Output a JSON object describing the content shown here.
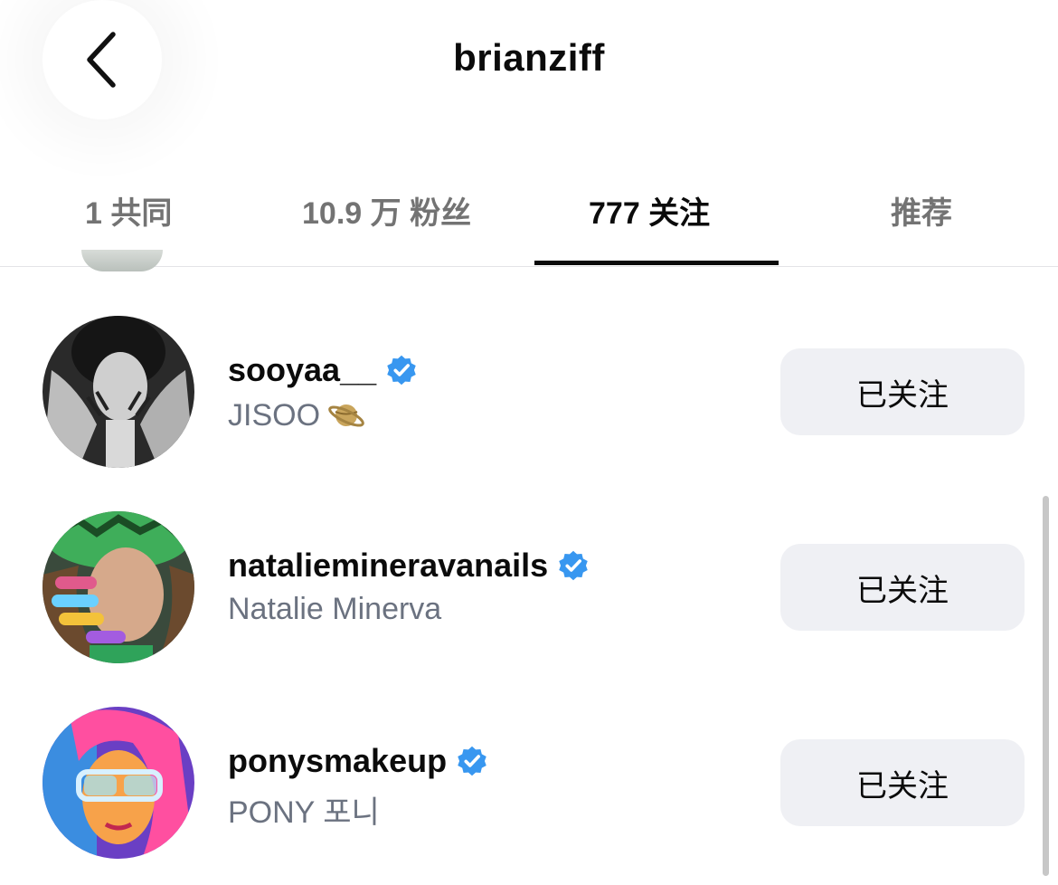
{
  "header": {
    "title": "brianziff",
    "back_icon": "chevron-left-icon"
  },
  "tabs": [
    {
      "label": "1 共同",
      "active": false
    },
    {
      "label": "10.9 万 粉丝",
      "active": false
    },
    {
      "label": "777 关注",
      "active": true
    },
    {
      "label": "推荐",
      "active": false
    }
  ],
  "accounts": [
    {
      "username": "sooyaa__",
      "verified": true,
      "display_name": "JISOO",
      "emoji": "ringed-planet",
      "button": "已关注"
    },
    {
      "username": "nataliemineravanails",
      "verified": true,
      "display_name": "Natalie Minerva",
      "button": "已关注"
    },
    {
      "username": "ponysmakeup",
      "verified": true,
      "display_name": "PONY 포니",
      "button": "已关注"
    }
  ],
  "colors": {
    "verified": "#3897f0",
    "button_bg": "#eff0f4",
    "secondary_text": "#6b7280",
    "active_underline": "#0b0b0b"
  }
}
